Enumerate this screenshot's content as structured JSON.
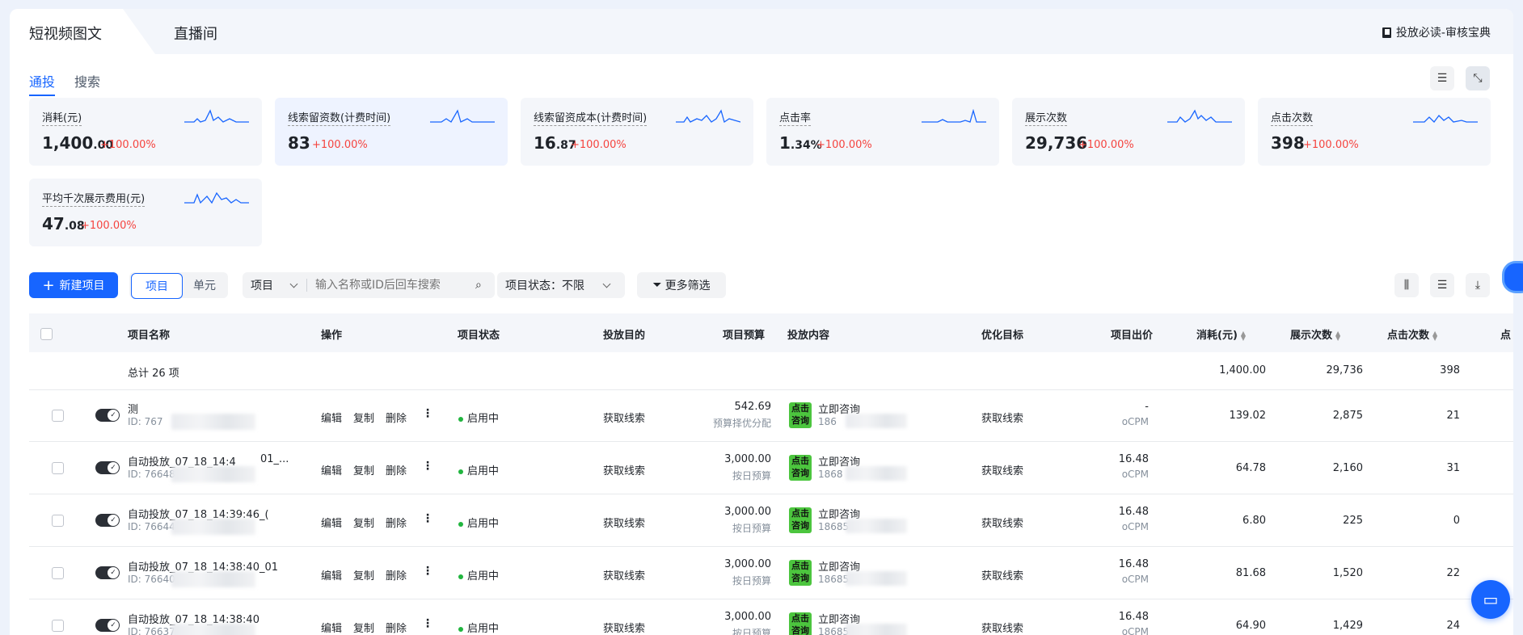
{
  "top_tabs": [
    {
      "label": "短视频图文"
    },
    {
      "label": "直播间"
    }
  ],
  "guide_link": "投放必读-审核宝典",
  "sub_tabs": [
    {
      "label": "通投"
    },
    {
      "label": "搜索"
    }
  ],
  "metrics": [
    {
      "label": "消耗(元)",
      "value_int": "1,400",
      "value_dec": ".00",
      "change": "+100.00%"
    },
    {
      "label": "线索留资数(计费时间)",
      "value_int": "83",
      "value_dec": "",
      "change": "+100.00%"
    },
    {
      "label": "线索留资成本(计费时间)",
      "value_int": "16",
      "value_dec": ".87",
      "change": "+100.00%"
    },
    {
      "label": "点击率",
      "value_int": "1",
      "value_dec": ".34%",
      "change": "+100.00%"
    },
    {
      "label": "展示次数",
      "value_int": "29,736",
      "value_dec": "",
      "change": "+100.00%"
    },
    {
      "label": "点击次数",
      "value_int": "398",
      "value_dec": "",
      "change": "+100.00%"
    },
    {
      "label": "平均千次展示费用(元)",
      "value_int": "47",
      "value_dec": ".08",
      "change": "+100.00%"
    }
  ],
  "toolbar": {
    "new_project": "新建项目",
    "seg_project": "项目",
    "seg_unit": "单元",
    "search_scope": "项目",
    "search_placeholder": "输入名称或ID后回车搜索",
    "status_label": "项目状态：",
    "status_value": "不限",
    "more_filter": "更多筛选"
  },
  "table": {
    "headers": [
      "项目名称",
      "操作",
      "项目状态",
      "投放目的",
      "项目预算",
      "投放内容",
      "优化目标",
      "项目出价",
      "消耗(元)",
      "展示次数",
      "点击次数",
      "点"
    ],
    "total": {
      "label": "总计 26 项",
      "cost": "1,400.00",
      "impressions": "29,736",
      "clicks": "398"
    },
    "actions": [
      "编辑",
      "复制",
      "删除"
    ],
    "rows": [
      {
        "name": "测",
        "id": "ID: 767",
        "status": "启用中",
        "purpose": "获取线索",
        "budget": "542.69",
        "budget_type": "预算择优分配",
        "content_title": "立即咨询",
        "content_sub": "186",
        "goal": "获取线索",
        "bid": "-",
        "bid_type": "oCPM",
        "cost": "139.02",
        "impressions": "2,875",
        "clicks": "21"
      },
      {
        "name": "自动投放_07_18_14:4",
        "name_tail": "01_...",
        "id": "ID: 7664807",
        "status": "启用中",
        "purpose": "获取线索",
        "budget": "3,000.00",
        "budget_type": "按日预算",
        "content_title": "立即咨询",
        "content_sub": "1868",
        "goal": "获取线索",
        "bid": "16.48",
        "bid_type": "oCPM",
        "cost": "64.78",
        "impressions": "2,160",
        "clicks": "31"
      },
      {
        "name": "自动投放_07_18_14:39:46_(",
        "id": "ID: 76644",
        "status": "启用中",
        "purpose": "获取线索",
        "budget": "3,000.00",
        "budget_type": "按日预算",
        "content_title": "立即咨询",
        "content_sub": "18685",
        "goal": "获取线索",
        "bid": "16.48",
        "bid_type": "oCPM",
        "cost": "6.80",
        "impressions": "225",
        "clicks": "0"
      },
      {
        "name": "自动投放_07_18_14:38:40_01",
        "id": "ID: 7664086",
        "status": "启用中",
        "purpose": "获取线索",
        "budget": "3,000.00",
        "budget_type": "按日预算",
        "content_title": "立即咨询",
        "content_sub": "18685",
        "goal": "获取线索",
        "bid": "16.48",
        "bid_type": "oCPM",
        "cost": "81.68",
        "impressions": "1,520",
        "clicks": "22"
      },
      {
        "name": "自动投放_07_18_14:38:40",
        "id": "ID: 766375",
        "status": "启用中",
        "purpose": "获取线索",
        "budget": "3,000.00",
        "budget_type": "按日预算",
        "content_title": "立即咨询",
        "content_sub": "18685",
        "goal": "获取线索",
        "bid": "16.48",
        "bid_type": "oCPM",
        "cost": "64.90",
        "impressions": "1,429",
        "clicks": "24"
      }
    ]
  },
  "thumb_text": [
    "点",
    "击",
    "咨",
    "询"
  ],
  "colors": {
    "accent": "#1765ff",
    "positive_change": "#f5443f",
    "status_on": "#21b53f",
    "thumb": "#4cc53e"
  }
}
